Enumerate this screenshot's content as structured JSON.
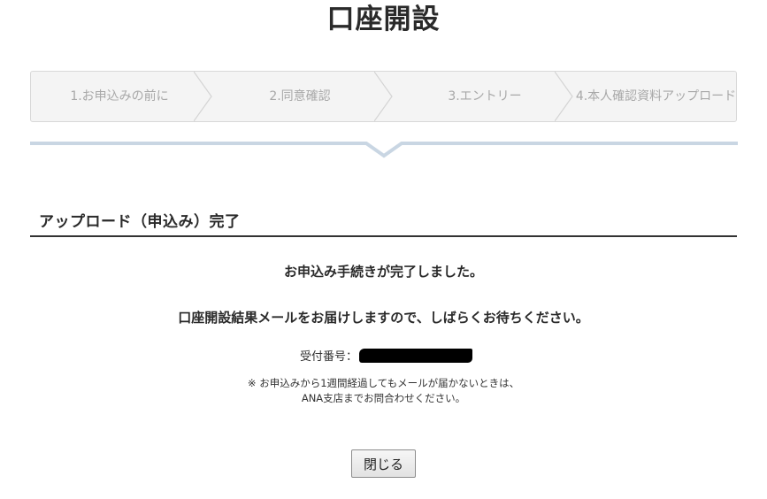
{
  "page": {
    "title": "口座開設"
  },
  "steps": [
    {
      "label": "1.お申込みの前に"
    },
    {
      "label": "2.同意確認"
    },
    {
      "label": "3.エントリー"
    },
    {
      "label": "4.本人確認資料アップロード"
    }
  ],
  "section": {
    "heading": "アップロード（申込み）完了"
  },
  "messages": {
    "complete": "お申込み手続きが完了しました。",
    "email_notice": "口座開設結果メールをお届けしますので、しばらくお待ちください。"
  },
  "receipt": {
    "label": "受付番号：",
    "value_redacted": true
  },
  "note": {
    "line1": "※ お申込みから1週間経過してもメールが届かないときは、",
    "line2": "ANA支店までお問合わせください。"
  },
  "buttons": {
    "close_label": "閉じる"
  },
  "colors": {
    "progress_line": "#c9d6e3",
    "stepper_bg": "#f4f4f4",
    "step_text": "#a8a8a8",
    "heading_rule": "#333333"
  }
}
